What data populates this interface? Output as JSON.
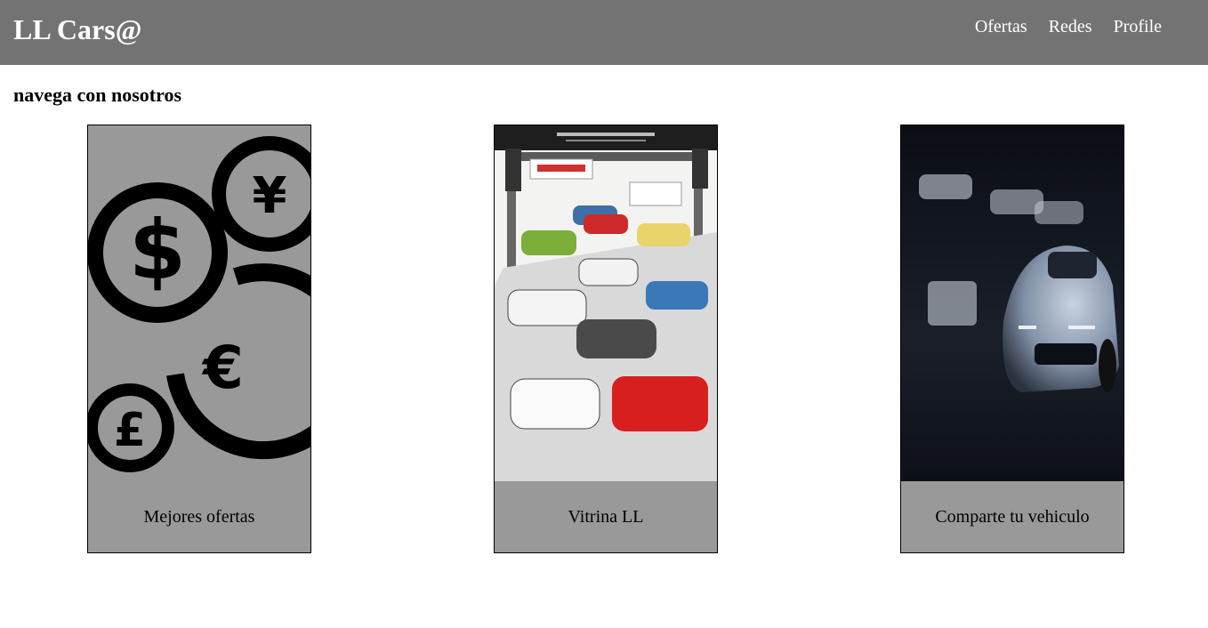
{
  "header": {
    "brand": "LL Cars@",
    "nav": [
      "Ofertas",
      "Redes",
      "Profile"
    ]
  },
  "main": {
    "title": "navega con nosotros",
    "cards": [
      {
        "caption": "Mejores ofertas",
        "image": "currency-coins-icon"
      },
      {
        "caption": "Vitrina LL",
        "image": "car-showroom-illustration"
      },
      {
        "caption": "Comparte tu vehiculo",
        "image": "dark-garage-sports-car-photo"
      }
    ]
  },
  "colors": {
    "header_bg": "#737373",
    "card_bg": "#999999",
    "text_light": "#ffffff"
  }
}
